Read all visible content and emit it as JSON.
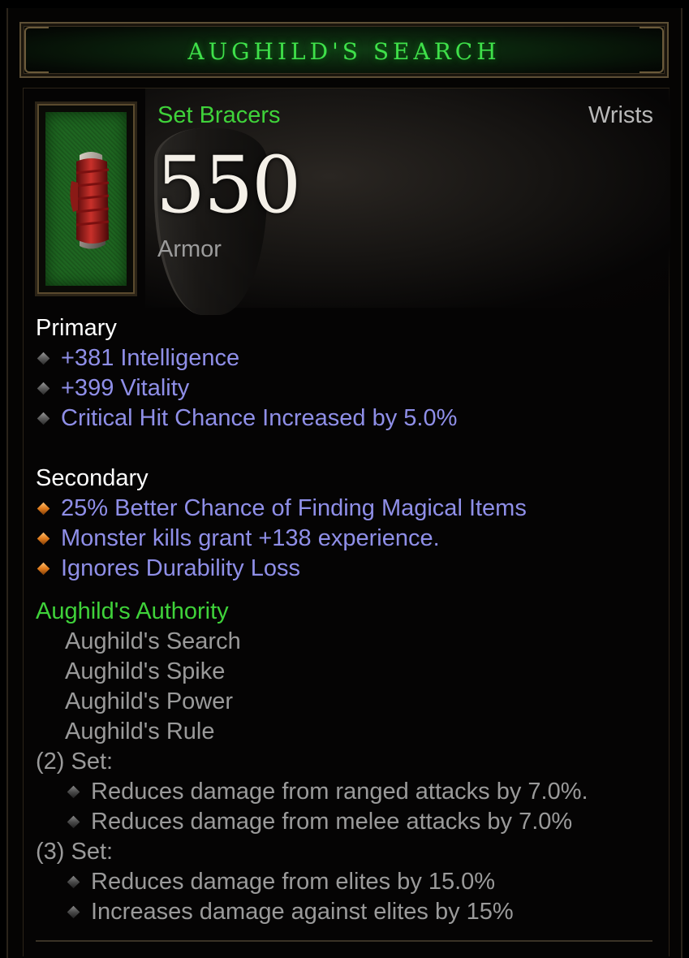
{
  "item": {
    "name": "AUGHILD'S SEARCH",
    "type": "Set Bracers",
    "slot": "Wrists",
    "armor_value": "550",
    "armor_label": "Armor",
    "icon": "bracer-icon"
  },
  "primary": {
    "heading": "Primary",
    "stats": [
      "+381 Intelligence",
      "+399 Vitality",
      "Critical Hit Chance Increased by 5.0%"
    ]
  },
  "secondary": {
    "heading": "Secondary",
    "stats": [
      "25% Better Chance of Finding Magical Items",
      "Monster kills grant +138 experience.",
      "Ignores Durability Loss"
    ]
  },
  "set": {
    "name": "Aughild's Authority",
    "pieces": [
      "Aughild's Search",
      "Aughild's Spike",
      "Aughild's Power",
      "Aughild's Rule"
    ],
    "bonuses": [
      {
        "label": "(2) Set:",
        "effects": [
          "Reduces damage from ranged attacks by 7.0%.",
          "Reduces damage from melee attacks by 7.0%"
        ]
      },
      {
        "label": "(3) Set:",
        "effects": [
          "Reduces damage from elites by 15.0%",
          "Increases damage against elites by 15%"
        ]
      }
    ]
  },
  "colors": {
    "set_green": "#3fd23a",
    "magic_blue": "#8f8fe8",
    "title_green": "#3fe04a"
  }
}
